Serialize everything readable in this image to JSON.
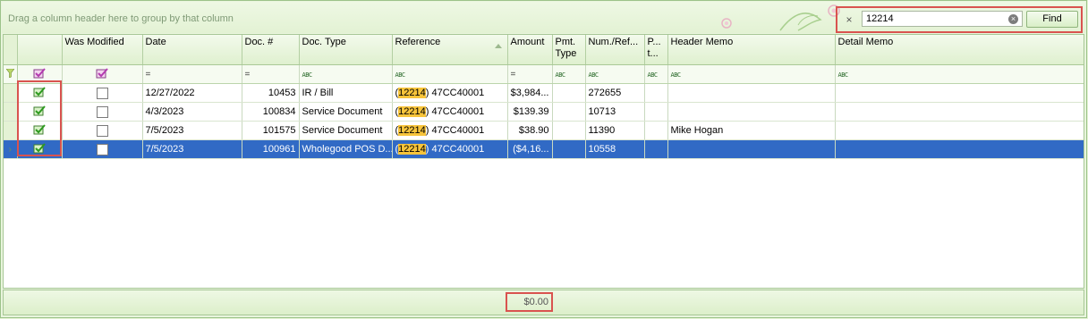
{
  "group_panel": {
    "hint": "Drag a column header here to group by that column"
  },
  "search": {
    "close_glyph": "×",
    "value": "12214",
    "clear_glyph": "×",
    "find_label": "Find"
  },
  "columns": [
    {
      "key": "indicator",
      "label": ""
    },
    {
      "key": "select",
      "label": ""
    },
    {
      "key": "was_modified",
      "label": "Was Modified"
    },
    {
      "key": "date",
      "label": "Date"
    },
    {
      "key": "doc_num",
      "label": "Doc. #"
    },
    {
      "key": "doc_type",
      "label": "Doc. Type"
    },
    {
      "key": "reference",
      "label": "Reference"
    },
    {
      "key": "amount",
      "label": "Amount"
    },
    {
      "key": "pmt_type",
      "label": "Pmt. Type"
    },
    {
      "key": "num_ref",
      "label": "Num./Ref..."
    },
    {
      "key": "p_t",
      "label": "P... t..."
    },
    {
      "key": "header_memo",
      "label": "Header Memo"
    },
    {
      "key": "detail_memo",
      "label": "Detail Memo"
    }
  ],
  "filter_row": {
    "equals_glyph": "=",
    "text_glyph": "ABC"
  },
  "rows": [
    {
      "checked": true,
      "modified": false,
      "date": "12/27/2022",
      "doc_num": "10453",
      "doc_type": "IR / Bill",
      "ref_prefix": "(",
      "ref_hl": "12214",
      "ref_rest": ") 47CC40001",
      "amount": "$3,984...",
      "pmt_type": "",
      "num_ref": "272655",
      "p_t": "",
      "header_memo": "",
      "detail_memo": ""
    },
    {
      "checked": true,
      "modified": false,
      "date": "4/3/2023",
      "doc_num": "100834",
      "doc_type": "Service Document",
      "ref_prefix": "(",
      "ref_hl": "12214",
      "ref_rest": ") 47CC40001",
      "amount": "$139.39",
      "pmt_type": "",
      "num_ref": "10713",
      "p_t": "",
      "header_memo": "",
      "detail_memo": ""
    },
    {
      "checked": true,
      "modified": false,
      "date": "7/5/2023",
      "doc_num": "101575",
      "doc_type": "Service Document",
      "ref_prefix": "(",
      "ref_hl": "12214",
      "ref_rest": ") 47CC40001",
      "amount": "$38.90",
      "pmt_type": "",
      "num_ref": "11390",
      "p_t": "",
      "header_memo": "Mike Hogan",
      "detail_memo": ""
    },
    {
      "checked": true,
      "modified": false,
      "selected": true,
      "current": true,
      "date": "7/5/2023",
      "doc_num": "100961",
      "doc_type": "Wholegood POS D...",
      "ref_prefix": "(",
      "ref_hl": "12214",
      "ref_rest": ") 47CC40001",
      "amount": "($4,16...",
      "pmt_type": "",
      "num_ref": "10558",
      "p_t": "",
      "header_memo": "",
      "detail_memo": ""
    }
  ],
  "footer": {
    "amount_total": "$0.00"
  },
  "colors": {
    "accent_green": "#dff0cf",
    "selection": "#316ac5",
    "highlight": "#f7c43a",
    "callout": "#d9534f"
  }
}
